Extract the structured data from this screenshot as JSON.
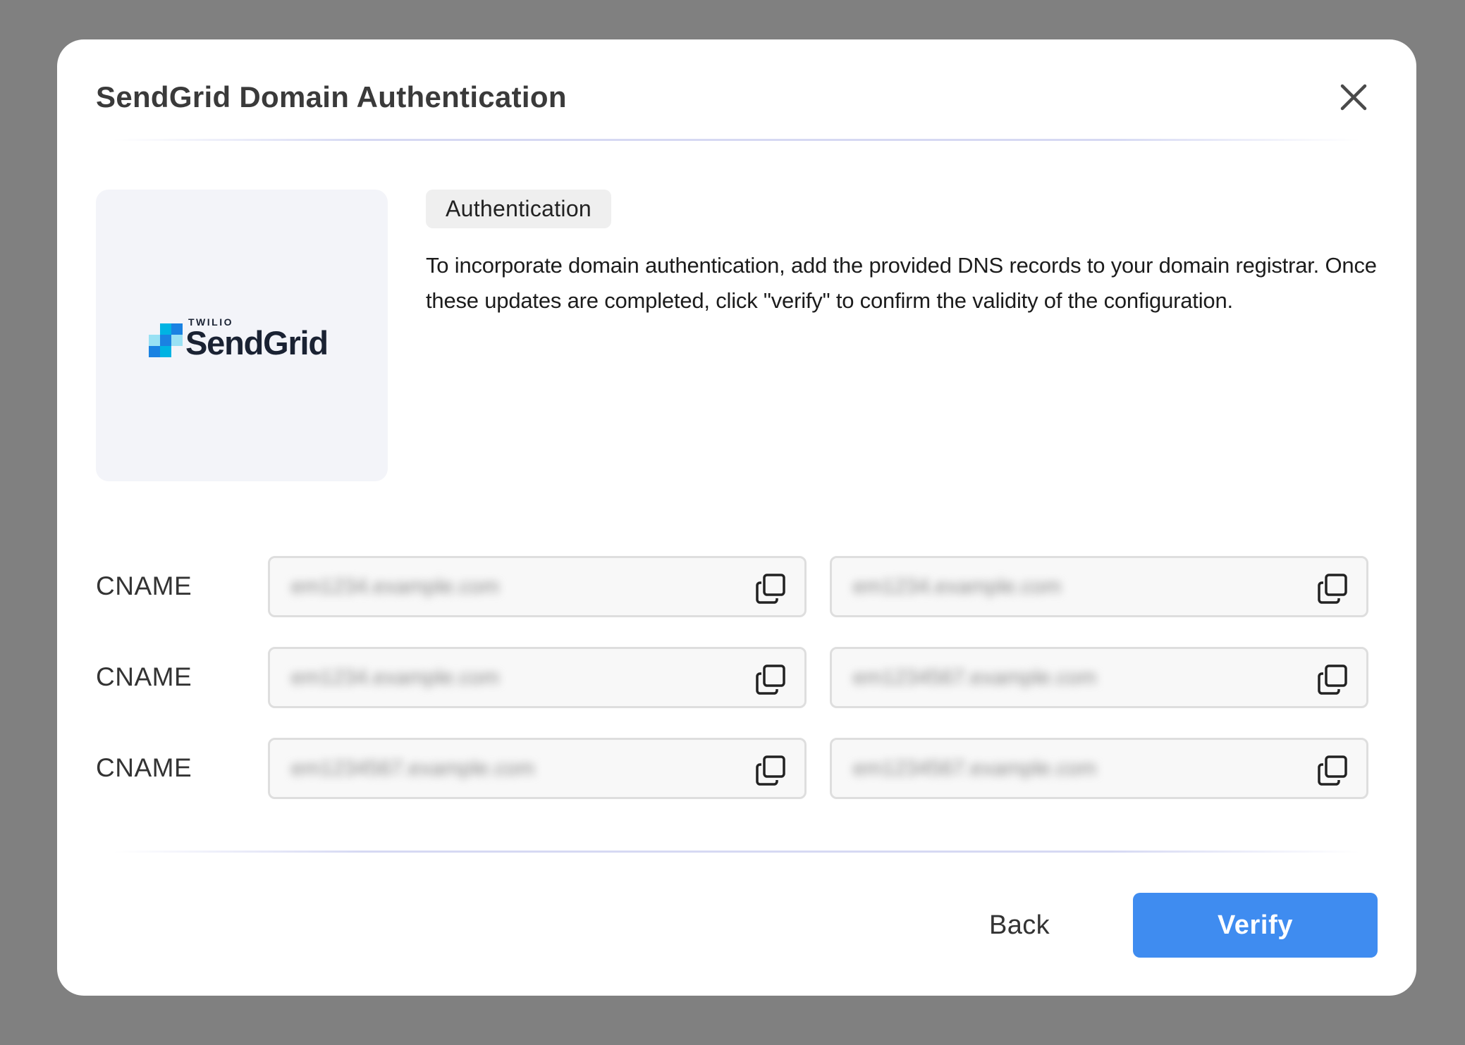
{
  "modal": {
    "title": "SendGrid Domain Authentication",
    "close_icon": "close-icon"
  },
  "logo": {
    "overline": "TWILIO",
    "wordmark": "SendGrid",
    "colors": {
      "dark": "#1a2233",
      "blue": "#1a82e2",
      "light_blue": "#00b3e3",
      "mid_blue": "#99e1f4"
    }
  },
  "section": {
    "tag": "Authentication",
    "description": "To incorporate domain authentication, add the provided DNS records to your domain registrar. Once these updates are completed, click \"verify\" to confirm the validity of the configuration."
  },
  "records": [
    {
      "type": "CNAME",
      "host": "em1234.example.com",
      "value": "em1234.example.com"
    },
    {
      "type": "CNAME",
      "host": "em1234.example.com",
      "value": "em1234567.example.com"
    },
    {
      "type": "CNAME",
      "host": "em1234567.example.com",
      "value": "em1234567.example.com"
    }
  ],
  "footer": {
    "back_label": "Back",
    "verify_label": "Verify"
  },
  "colors": {
    "backdrop": "#808080",
    "primary": "#3f8cf0",
    "field_border": "#dedede"
  }
}
